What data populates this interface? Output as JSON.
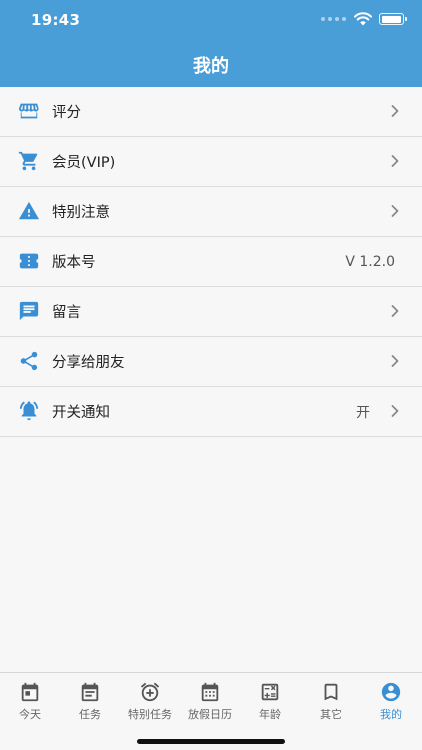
{
  "status_bar": {
    "time": "19:43",
    "battery_level": 0.95
  },
  "header": {
    "title": "我的"
  },
  "menu": {
    "items": [
      {
        "label": "评分",
        "icon": "storefront-icon",
        "value": "",
        "chevron": true
      },
      {
        "label": "会员(VIP)",
        "icon": "cart-icon",
        "value": "",
        "chevron": true
      },
      {
        "label": "特别注意",
        "icon": "warning-icon",
        "value": "",
        "chevron": true
      },
      {
        "label": "版本号",
        "icon": "ticket-icon",
        "value": "V 1.2.0",
        "chevron": false
      },
      {
        "label": "留言",
        "icon": "message-icon",
        "value": "",
        "chevron": true
      },
      {
        "label": "分享给朋友",
        "icon": "share-icon",
        "value": "",
        "chevron": true
      },
      {
        "label": "开关通知",
        "icon": "alarm-icon",
        "value": "开",
        "chevron": true
      }
    ]
  },
  "tabbar": {
    "tabs": [
      {
        "label": "今天",
        "icon": "calendar-today-icon",
        "active": false
      },
      {
        "label": "任务",
        "icon": "task-list-icon",
        "active": false
      },
      {
        "label": "特别任务",
        "icon": "alarm-add-icon",
        "active": false
      },
      {
        "label": "放假日历",
        "icon": "calendar-grid-icon",
        "active": false
      },
      {
        "label": "年龄",
        "icon": "calculator-icon",
        "active": false
      },
      {
        "label": "其它",
        "icon": "bookmark-icon",
        "active": false
      },
      {
        "label": "我的",
        "icon": "account-circle-icon",
        "active": true
      }
    ]
  },
  "colors": {
    "header_bg": "#4a9ed8",
    "accent": "#3a8fd4",
    "icon_blue": "#3a8fd4",
    "list_bg": "#f7f7f7",
    "separator": "#dcdcdc",
    "tab_inactive": "#666666"
  }
}
